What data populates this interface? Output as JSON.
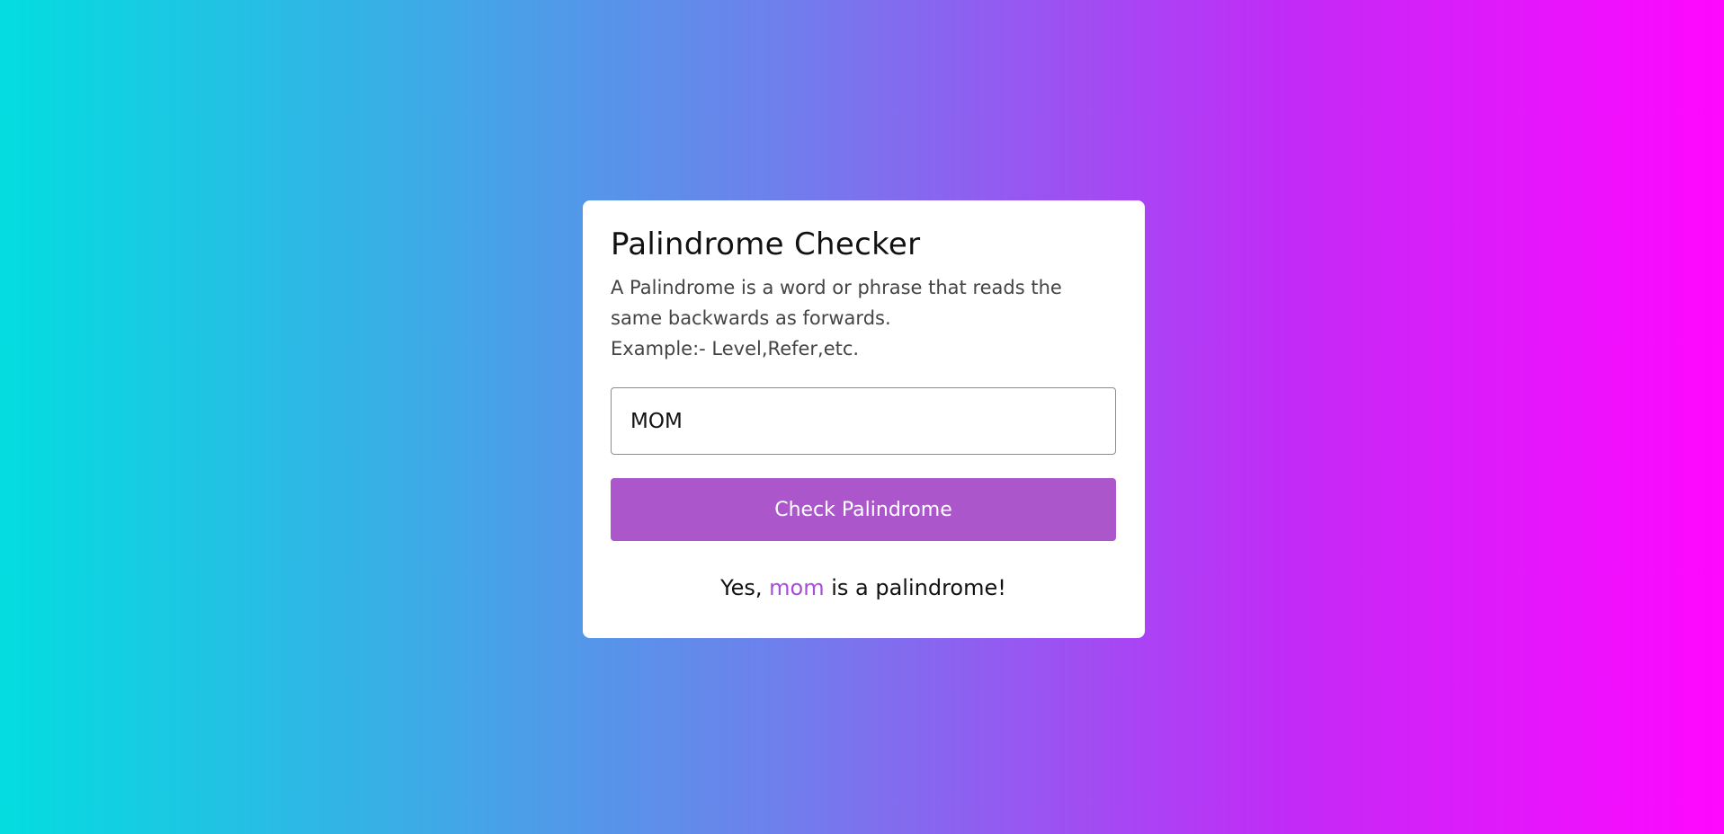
{
  "colors": {
    "gradient_start": "#03dde0",
    "gradient_end": "#ff07fe",
    "card_background": "#ffffff",
    "button_background": "#ac56cb",
    "highlight_word": "#a64ed6"
  },
  "card": {
    "title": "Palindrome Checker",
    "description_line_1": "A Palindrome is a word or phrase that reads the same backwards as forwards.",
    "description_line_2": "Example:- Level,Refer,etc."
  },
  "input": {
    "value": "MOM"
  },
  "button": {
    "label": "Check Palindrome"
  },
  "result": {
    "prefix": "Yes,",
    "word": "mom",
    "suffix": "is a palindrome!"
  }
}
